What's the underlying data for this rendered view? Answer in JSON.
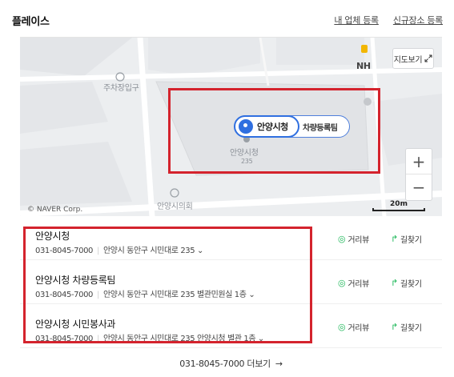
{
  "header": {
    "title": "플레이스",
    "links": [
      "내 업체 등록",
      "신규장소 등록"
    ]
  },
  "map": {
    "labels": {
      "parking": "주차장입구",
      "nh": "NH",
      "city_hall": "안양시청",
      "city_hall_num": "235",
      "council": "안양시의회"
    },
    "pin": {
      "main": "안양시청",
      "sub": "차량등록팀"
    },
    "map_button": "지도보기",
    "zoom_in": "+",
    "zoom_out": "−",
    "copyright": "© NAVER Corp.",
    "scale": "20m"
  },
  "results": [
    {
      "name": "안양시청",
      "phone": "031-8045-7000",
      "address": "안양시 동안구 시민대로 235",
      "street_view": "거리뷰",
      "route": "길찾기"
    },
    {
      "name": "안양시청 차량등록팀",
      "phone": "031-8045-7000",
      "address": "안양시 동안구 시민대로 235 별관민원실 1층",
      "street_view": "거리뷰",
      "route": "길찾기"
    },
    {
      "name": "안양시청 시민봉사과",
      "phone": "031-8045-7000",
      "address": "안양시 동안구 시민대로 235 안양시청 별관 1층",
      "street_view": "거리뷰",
      "route": "길찾기"
    }
  ],
  "more": {
    "label": "031-8045-7000 더보기",
    "arrow": "→"
  },
  "colors": {
    "highlight": "#d4232d",
    "pin_blue": "#2f6fe0",
    "green": "#1fb85a"
  }
}
